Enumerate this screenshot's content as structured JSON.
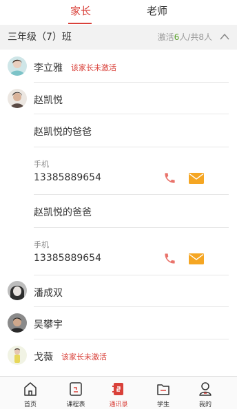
{
  "tabs": {
    "parent": "家长",
    "teacher": "老师"
  },
  "class": {
    "title": "三年级（7）班",
    "stats_prefix": "激活",
    "stats_active": "6",
    "stats_middle": "人/共",
    "stats_total": "8",
    "stats_suffix": "人"
  },
  "parents": [
    {
      "name": "李立雅",
      "badge": "该家长未激活"
    },
    {
      "name": "赵凯悦"
    },
    {
      "name": "潘成双"
    },
    {
      "name": "吴攀宇"
    },
    {
      "name": "戈薇",
      "badge": "该家长未激活"
    }
  ],
  "guardians": [
    {
      "title": "赵凯悦的爸爸",
      "phone_label": "手机",
      "phone": "13385889654"
    },
    {
      "title": "赵凯悦的爸爸",
      "phone_label": "手机",
      "phone": "13385889654"
    }
  ],
  "nav": [
    {
      "label": "首页",
      "icon": "home-icon"
    },
    {
      "label": "课程表",
      "icon": "schedule-icon"
    },
    {
      "label": "通讯录",
      "icon": "contacts-icon",
      "active": true
    },
    {
      "label": "学生",
      "icon": "student-folder-icon"
    },
    {
      "label": "我的",
      "icon": "profile-icon"
    }
  ],
  "colors": {
    "accent": "#d9413a",
    "active_count": "#5aa02c",
    "phone": "#e9736b",
    "mail": "#f5a623"
  }
}
